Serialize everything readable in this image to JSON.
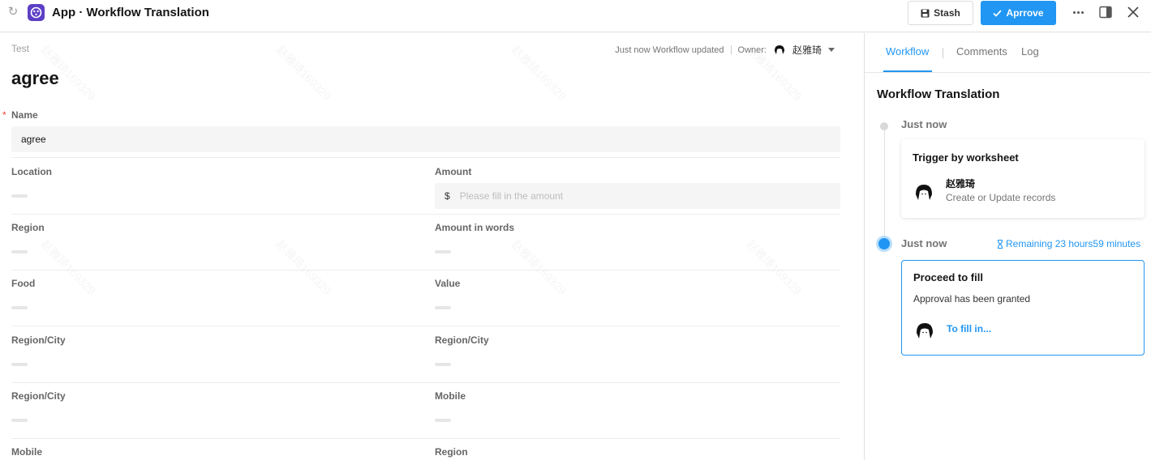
{
  "topbar": {
    "app_title": "App · Workflow Translation",
    "stash_label": "Stash",
    "approve_label": "Aprrove"
  },
  "record": {
    "breadcrumb": "Test",
    "title": "agree",
    "status": "Just now Workflow updated",
    "owner_label": "Owner:",
    "owner_name": "赵雅琦"
  },
  "fields": {
    "name_label": "Name",
    "name_value": "agree",
    "location_label": "Location",
    "amount_label": "Amount",
    "amount_currency": "$",
    "amount_placeholder": "Please fill in the amount",
    "region_label": "Region",
    "amount_words_label": "Amount in words",
    "food_label": "Food",
    "value_label": "Value",
    "region_city_1_label": "Region/City",
    "region_city_2_label": "Region/City",
    "region_city_3_label": "Region/City",
    "mobile_1_label": "Mobile",
    "mobile_2_label": "Mobile",
    "region_2_label": "Region"
  },
  "sidebar": {
    "tabs": [
      {
        "label": "Workflow",
        "active": true
      },
      {
        "label": "Comments",
        "active": false
      },
      {
        "label": "Log",
        "active": false
      }
    ],
    "workflow_title": "Workflow Translation",
    "steps": [
      {
        "time": "Just now",
        "card_title": "Trigger by worksheet",
        "user": "赵雅琦",
        "action": "Create or Update records"
      },
      {
        "time": "Just now",
        "remaining": "Remaining 23 hours59 minutes",
        "card_title": "Proceed to fill",
        "description": "Approval has been granted",
        "link": "To fill in..."
      }
    ]
  },
  "watermark": "赵雅琦169329",
  "colors": {
    "accent": "#2196f3",
    "brand": "#5b3fc4",
    "required": "#f44336"
  }
}
